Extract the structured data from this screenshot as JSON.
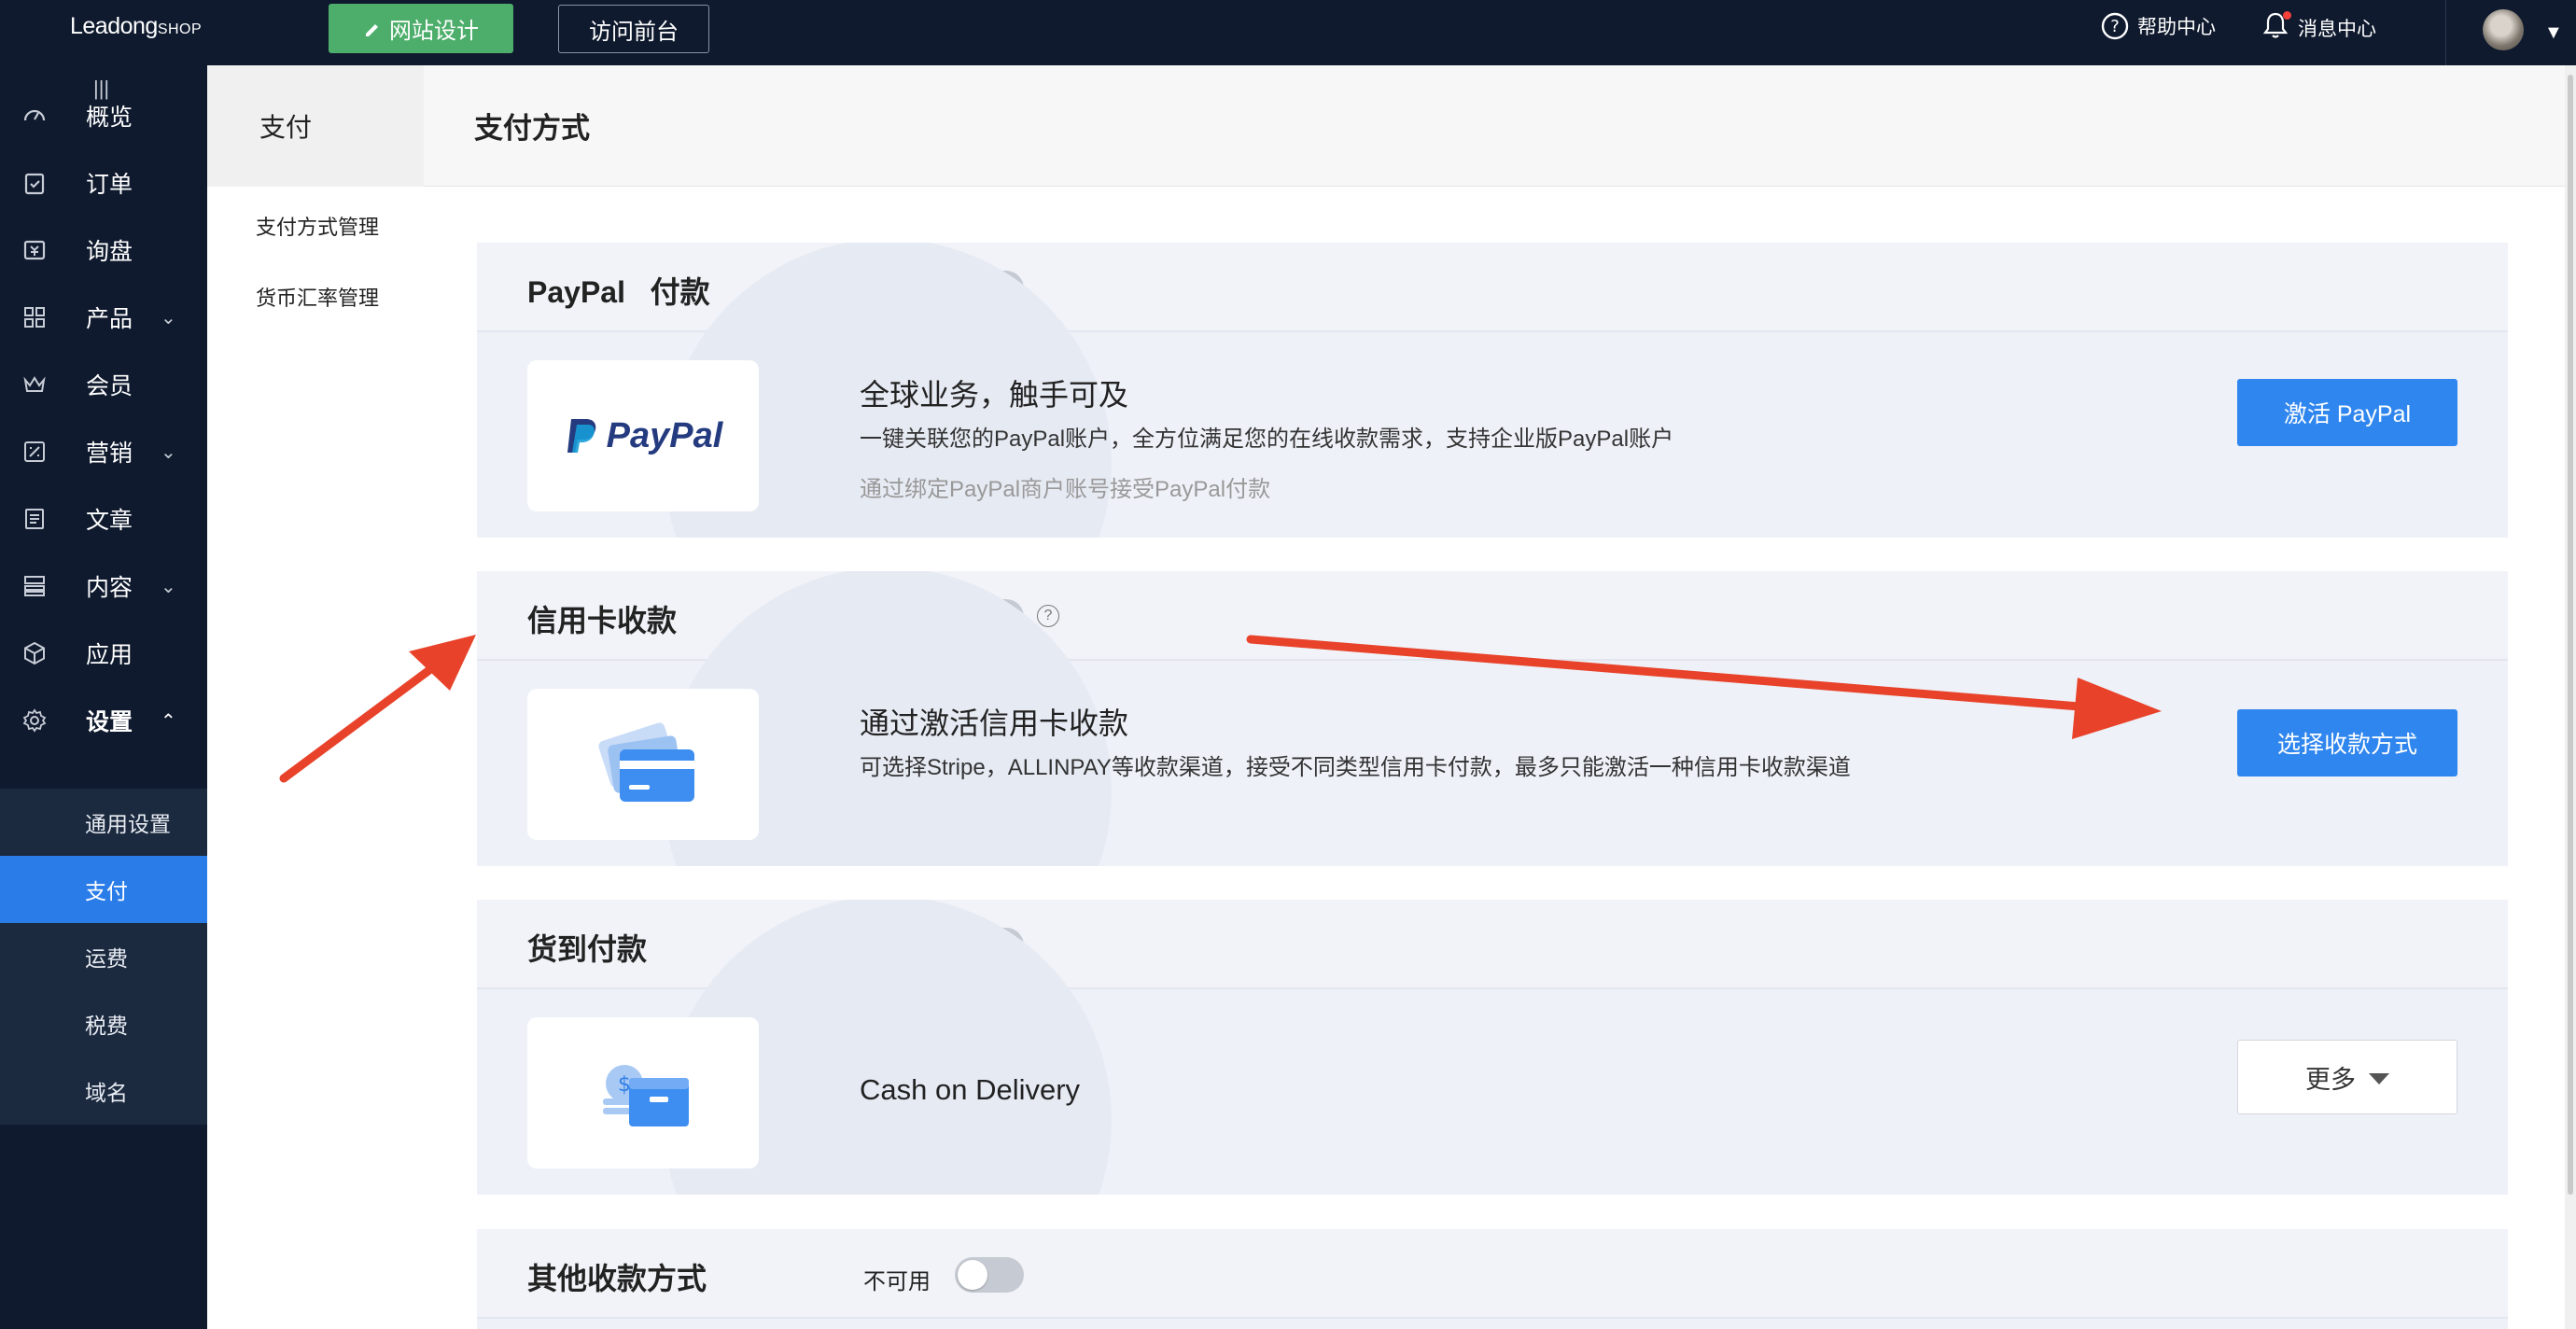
{
  "topbar": {
    "logo_main": "Leadong",
    "logo_sub": "SHOP",
    "design_button": "网站设计",
    "visit_button": "访问前台",
    "help": "帮助中心",
    "messages": "消息中心"
  },
  "nav": {
    "collapse_glyph": "|||",
    "items": [
      {
        "label": "概览",
        "icon": "dashboard-icon"
      },
      {
        "label": "订单",
        "icon": "order-icon"
      },
      {
        "label": "询盘",
        "icon": "inquiry-icon"
      },
      {
        "label": "产品",
        "icon": "product-icon"
      },
      {
        "label": "会员",
        "icon": "member-icon"
      },
      {
        "label": "营销",
        "icon": "marketing-icon"
      },
      {
        "label": "文章",
        "icon": "article-icon"
      },
      {
        "label": "内容",
        "icon": "content-icon"
      },
      {
        "label": "应用",
        "icon": "app-icon"
      },
      {
        "label": "设置",
        "icon": "settings-icon"
      }
    ],
    "sub_items": [
      {
        "label": "通用设置"
      },
      {
        "label": "支付"
      },
      {
        "label": "运费"
      },
      {
        "label": "税费"
      },
      {
        "label": "域名"
      }
    ],
    "active_sub": "支付"
  },
  "secondary": {
    "title": "支付",
    "items": [
      "支付方式管理",
      "货币汇率管理"
    ]
  },
  "main": {
    "title": "支付方式",
    "status_unavailable": "不可用",
    "cards": [
      {
        "title": "PayPal   付款",
        "enabled": false,
        "logo_text": "PayPal",
        "body_title": "全球业务，触手可及",
        "body_desc": "一键关联您的PayPal账户，全方位满足您的在线收款需求，支持企业版PayPal账户",
        "body_note": "通过绑定PayPal商户账号接受PayPal付款",
        "button": "激活 PayPal"
      },
      {
        "title": "信用卡收款",
        "enabled": false,
        "help_glyph": "?",
        "body_title": "通过激活信用卡收款",
        "body_desc": "可选择Stripe，ALLINPAY等收款渠道，接受不同类型信用卡付款，最多只能激活一种信用卡收款渠道",
        "button": "选择收款方式"
      },
      {
        "title": "货到付款",
        "enabled": false,
        "body_title": "Cash on Delivery",
        "button": "更多"
      },
      {
        "title": "其他收款方式",
        "enabled": false
      }
    ]
  },
  "colors": {
    "topbar_bg": "#0f1a2e",
    "accent_blue": "#2f86ee",
    "green": "#4cae6a",
    "arrow_red": "#e8432a"
  }
}
